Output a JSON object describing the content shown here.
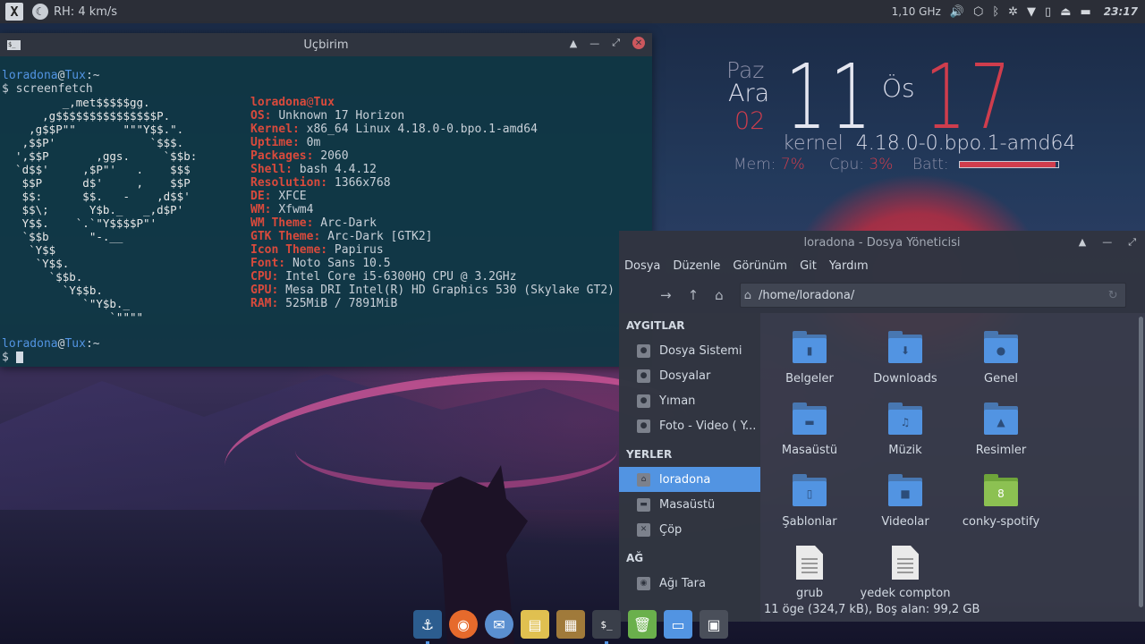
{
  "top_panel": {
    "menu_label": "X",
    "network_text": "RH: 4 km/s",
    "cpu_freq": "1,10 GHz",
    "clock": "23:17"
  },
  "conky": {
    "day": "Paz",
    "month": "Ara",
    "date": "02",
    "hour": "11",
    "ampm": "Ös",
    "minute": "17",
    "kernel_label": "kernel",
    "kernel_value": "4.18.0-0.bpo.1-amd64",
    "mem_label": "Mem:",
    "mem_value": "7%",
    "cpu_label": "Cpu:",
    "cpu_value": "3%",
    "batt_label": "Batt:",
    "batt_fraction": 0.97
  },
  "terminal": {
    "title": "Uçbirim",
    "user": "loradona",
    "host": "Tux",
    "path": ":~",
    "command": "$ screenfetch",
    "prompt": "$",
    "logo": "         _,met$$$$$gg.\n      ,g$$$$$$$$$$$$$$$P.\n    ,g$$P\"\"       \"\"\"Y$$.\".\n   ,$$P'              `$$$.\n  ',$$P       ,ggs.     `$$b:\n  `d$$'     ,$P\"'   .    $$$\n   $$P      d$'     ,    $$P\n   $$:      $$.   -    ,d$$'\n   $$\\;      Y$b._   _,d$P'\n   Y$$.    `.`\"Y$$$$P\"'\n   `$$b      \"-.__\n    `Y$$\n     `Y$$.\n       `$$b.\n         `Y$$b.\n            `\"Y$b._\n                `\"\"\"\"",
    "info_header_user": "loradona",
    "info_header_host": "Tux",
    "info": [
      {
        "k": "OS:",
        "v": "Unknown 17 Horizon"
      },
      {
        "k": "Kernel:",
        "v": "x86_64 Linux 4.18.0-0.bpo.1-amd64"
      },
      {
        "k": "Uptime:",
        "v": "0m"
      },
      {
        "k": "Packages:",
        "v": "2060"
      },
      {
        "k": "Shell:",
        "v": "bash 4.4.12"
      },
      {
        "k": "Resolution:",
        "v": "1366x768"
      },
      {
        "k": "DE:",
        "v": "XFCE"
      },
      {
        "k": "WM:",
        "v": "Xfwm4"
      },
      {
        "k": "WM Theme:",
        "v": "Arc-Dark"
      },
      {
        "k": "GTK Theme:",
        "v": "Arc-Dark [GTK2]"
      },
      {
        "k": "Icon Theme:",
        "v": "Papirus"
      },
      {
        "k": "Font:",
        "v": "Noto Sans 10.5"
      },
      {
        "k": "CPU:",
        "v": "Intel Core i5-6300HQ CPU @ 3.2GHz"
      },
      {
        "k": "GPU:",
        "v": "Mesa DRI Intel(R) HD Graphics 530 (Skylake GT2)"
      },
      {
        "k": "RAM:",
        "v": "525MiB / 7891MiB"
      }
    ]
  },
  "file_manager": {
    "title": "loradona - Dosya Yöneticisi",
    "menu": [
      "Dosya",
      "Düzenle",
      "Görünüm",
      "Git",
      "Yardım"
    ],
    "address": "/home/loradona/",
    "sidebar": {
      "devices_header": "AYGITLAR",
      "devices": [
        "Dosya Sistemi",
        "Dosyalar",
        "Yıman",
        "Foto - Video ( Y..."
      ],
      "places_header": "YERLER",
      "places": [
        "loradona",
        "Masaüstü",
        "Çöp"
      ],
      "network_header": "AĞ",
      "network": [
        "Ağı Tara"
      ]
    },
    "items": [
      {
        "name": "Belgeler",
        "glyph": "▮"
      },
      {
        "name": "Downloads",
        "glyph": "⬇"
      },
      {
        "name": "Genel",
        "glyph": "●"
      },
      {
        "name": "Masaüstü",
        "glyph": "▬"
      },
      {
        "name": "Müzik",
        "glyph": "♫"
      },
      {
        "name": "Resimler",
        "glyph": "▲"
      },
      {
        "name": "Şablonlar",
        "glyph": "▯"
      },
      {
        "name": "Videolar",
        "glyph": "■"
      },
      {
        "name": "conky-spotify",
        "glyph": "8"
      },
      {
        "name": "grub",
        "glyph": ""
      },
      {
        "name": "yedek compton",
        "glyph": ""
      }
    ],
    "status": "11 öge (324,7 kB), Boş alan: 99,2 GB"
  },
  "dock": [
    "anchor-icon",
    "firefox-icon",
    "thunderbird-icon",
    "notes-icon",
    "archive-icon",
    "terminal-icon",
    "trash-icon",
    "display-icon",
    "window-icon"
  ]
}
